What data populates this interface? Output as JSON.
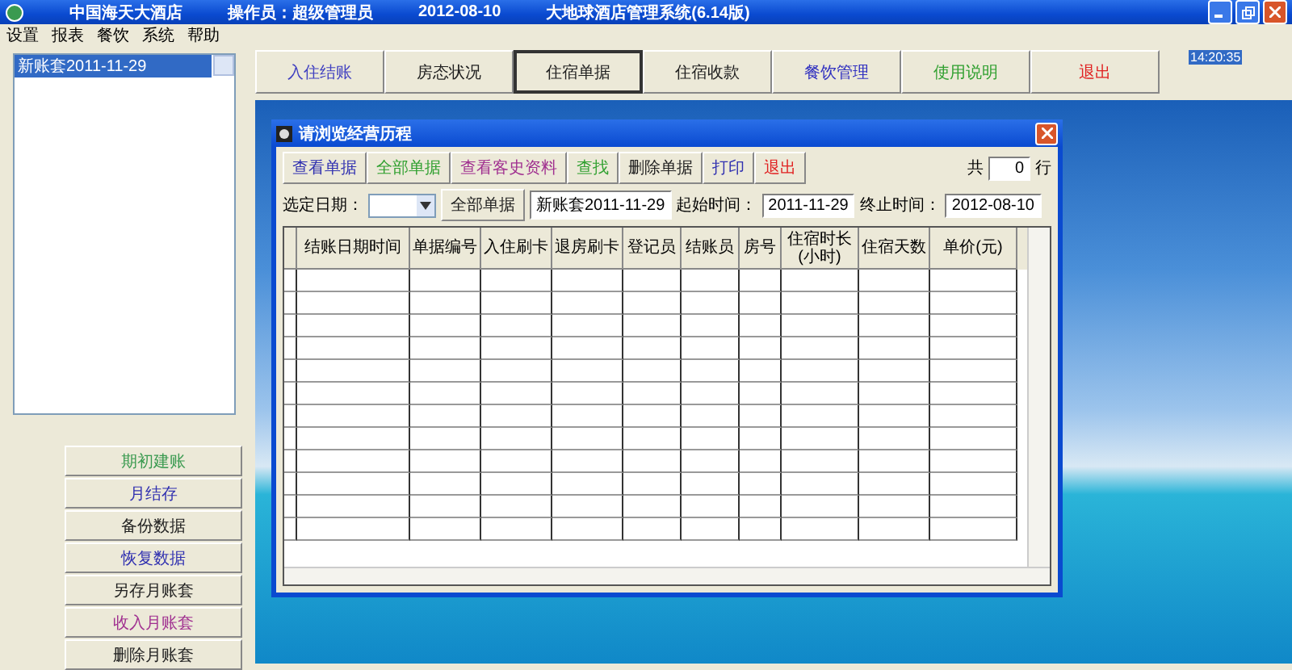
{
  "window": {
    "title": "中国海天大酒店",
    "operator": "操作员：超级管理员",
    "date": "2012-08-10",
    "system": "大地球酒店管理系统(6.14版)"
  },
  "menu": [
    "设置",
    "报表",
    "餐饮",
    "系统",
    "帮助"
  ],
  "sidebar": {
    "list": [
      {
        "label": "新账套2011-11-29",
        "selected": true
      }
    ],
    "buttons": [
      {
        "label": "期初建账",
        "color": "#3a9a50"
      },
      {
        "label": "月结存",
        "color": "#3030b0"
      },
      {
        "label": "备份数据",
        "color": "#202020"
      },
      {
        "label": "恢复数据",
        "color": "#3030b0"
      },
      {
        "label": "另存月账套",
        "color": "#202020"
      },
      {
        "label": "收入月账套",
        "color": "#a03090"
      },
      {
        "label": "删除月账套",
        "color": "#202020"
      }
    ]
  },
  "toolbar": [
    {
      "label": "入住结账",
      "color": "#4040c0",
      "selected": false
    },
    {
      "label": "房态状况",
      "color": "#202020",
      "selected": false
    },
    {
      "label": "住宿单据",
      "color": "#202020",
      "selected": true
    },
    {
      "label": "住宿收款",
      "color": "#202020",
      "selected": false
    },
    {
      "label": "餐饮管理",
      "color": "#3030c0",
      "selected": false
    },
    {
      "label": "使用说明",
      "color": "#30a030",
      "selected": false
    },
    {
      "label": "退出",
      "color": "#e02020",
      "selected": false
    }
  ],
  "clock": "14:20:35",
  "dialog": {
    "title": "请浏览经营历程",
    "buttons": [
      {
        "label": "查看单据",
        "color": "#3030b0"
      },
      {
        "label": "全部单据",
        "color": "#30a030"
      },
      {
        "label": "查看客史资料",
        "color": "#a03090"
      },
      {
        "label": "查找",
        "color": "#30a030"
      },
      {
        "label": "删除单据",
        "color": "#202020"
      },
      {
        "label": "打印",
        "color": "#3030b0"
      },
      {
        "label": "退出",
        "color": "#e02020"
      }
    ],
    "count_prefix": "共",
    "count": "0",
    "count_suffix": "行",
    "date_label": "选定日期：",
    "all_button": "全部单据",
    "account": "新账套2011-11-29",
    "start_label": "起始时间：",
    "start": "2011-11-29",
    "end_label": "终止时间：",
    "end": "2012-08-10",
    "columns": [
      "结账日期时间",
      "单据编号",
      "入住刷卡",
      "退房刷卡",
      "登记员",
      "结账员",
      "房号",
      "住宿时长(小时)",
      "住宿天数",
      "单价(元)"
    ]
  }
}
